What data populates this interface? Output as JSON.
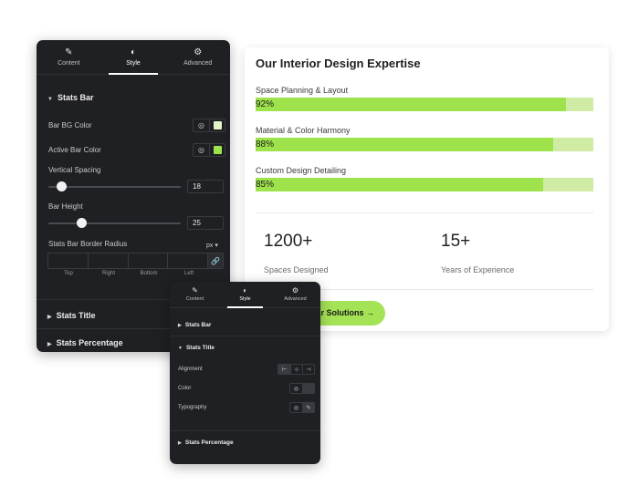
{
  "preview": {
    "title": "Our Interior Design Expertise",
    "skills": [
      {
        "label": "Space Planning & Layout",
        "percent_text": "92%",
        "value": 92
      },
      {
        "label": "Material & Color Harmony",
        "percent_text": "88%",
        "value": 88
      },
      {
        "label": "Custom Design Detailing",
        "percent_text": "85%",
        "value": 85
      }
    ],
    "counters": [
      {
        "number": "1200+",
        "label": "Spaces Designed"
      },
      {
        "number": "15+",
        "label": "Years of Experience"
      }
    ],
    "cta_label": "r Solutions →",
    "bar_bg_color": "#cfeba4",
    "active_bar_color": "#9ee34b"
  },
  "panel_main": {
    "tabs": [
      {
        "label": "Content",
        "icon": "pencil-icon"
      },
      {
        "label": "Style",
        "icon": "contrast-icon"
      },
      {
        "label": "Advanced",
        "icon": "gear-icon"
      }
    ],
    "sections": {
      "stats_bar": "Stats Bar",
      "stats_title": "Stats Title",
      "stats_percentage": "Stats Percentage"
    },
    "bar_bg_color_label": "Bar BG Color",
    "active_bar_color_label": "Active Bar Color",
    "vertical_spacing_label": "Vertical Spacing",
    "vertical_spacing_value": "18",
    "vertical_spacing_fraction": 0.1,
    "bar_height_label": "Bar Height",
    "bar_height_value": "25",
    "bar_height_fraction": 0.25,
    "border_radius_label": "Stats Bar Border Radius",
    "unit": "px",
    "radius_sides": [
      "Top",
      "Right",
      "Bottom",
      "Left"
    ],
    "swatch_colors": {
      "bar_bg": "#e3f4cb",
      "active": "#9ee34b"
    }
  },
  "panel_small": {
    "tabs": [
      {
        "label": "Content",
        "icon": "pencil-icon"
      },
      {
        "label": "Style",
        "icon": "contrast-icon"
      },
      {
        "label": "Advanced",
        "icon": "gear-icon"
      }
    ],
    "sections": {
      "stats_bar": "Stats Bar",
      "stats_title": "Stats Title",
      "stats_percentage": "Stats Percentage"
    },
    "alignment_label": "Alignment",
    "color_label": "Color",
    "typography_label": "Typography"
  }
}
